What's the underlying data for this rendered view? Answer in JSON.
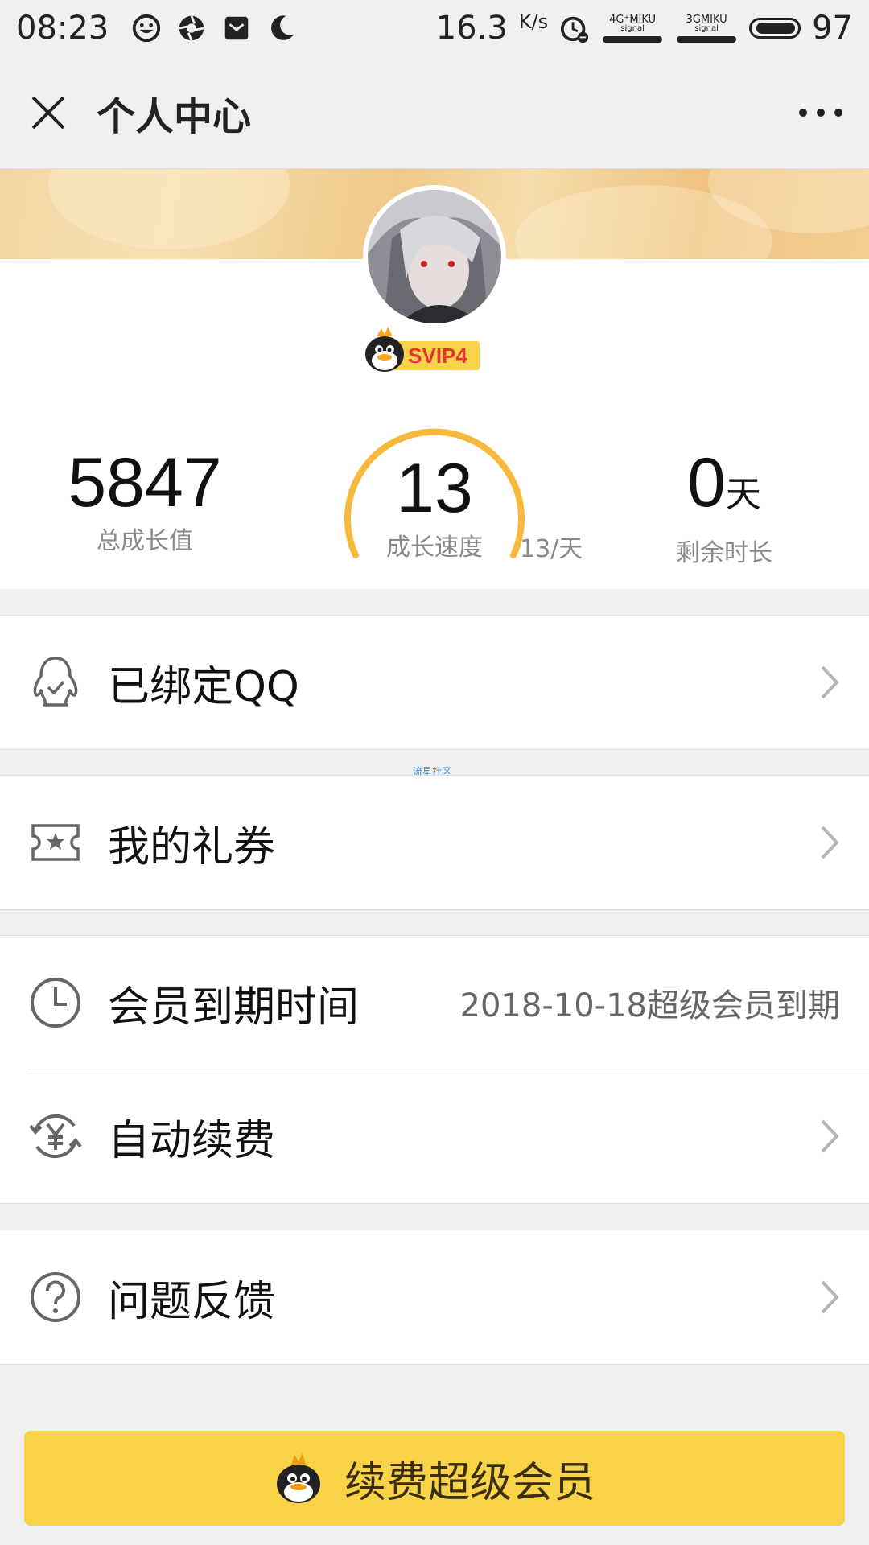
{
  "status_bar": {
    "time": "08:23",
    "speed": "16.3",
    "speed_unit": "K/s",
    "signal1": "4G⁺MIKU",
    "signal1_sub": "signal",
    "signal2": "3GMIKU",
    "signal2_sub": "signal",
    "battery": "97"
  },
  "header": {
    "title": "个人中心"
  },
  "profile": {
    "badge_text": "SVIP4",
    "total_growth": "5847",
    "total_growth_label": "总成长值",
    "growth_speed": "13",
    "growth_speed_label": "成长速度",
    "growth_rate": "13/天",
    "remaining": "0",
    "remaining_unit": "天",
    "remaining_label": "剩余时长"
  },
  "menu": {
    "bound_qq": "已绑定QQ",
    "coupons": "我的礼券",
    "expiry_label": "会员到期时间",
    "expiry_value": "2018-10-18超级会员到期",
    "auto_renew": "自动续费",
    "feedback": "问题反馈"
  },
  "watermark": "流星社区",
  "cta": {
    "label": "续费超级会员"
  },
  "colors": {
    "accent_yellow": "#f9d347",
    "gauge_yellow": "#f6b93b",
    "icon_gray": "#666666"
  }
}
